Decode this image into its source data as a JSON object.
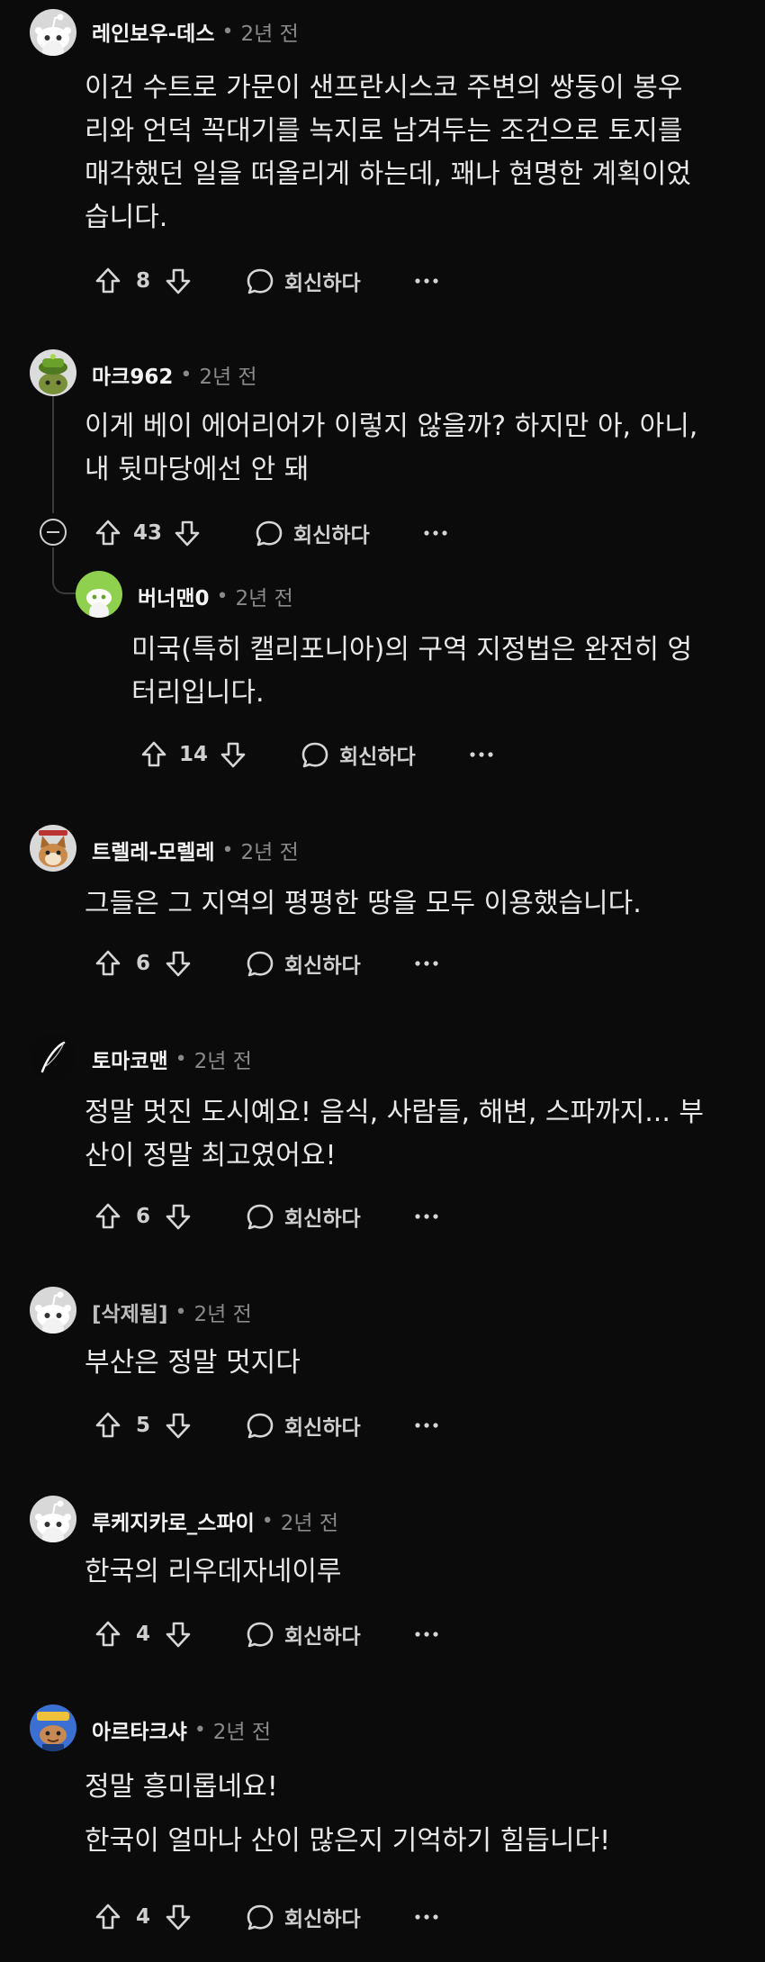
{
  "comments": [
    {
      "author": "레인보우-데스",
      "time": "2년 전",
      "lines": [
        "이건 수트로 가문이 샌프란시스코 주변의 쌍둥이 봉우",
        "리와 언덕 꼭대기를 녹지로 남겨두는 조건으로 토지를",
        "매각했던 일을 떠올리게 하는데, 꽤나 현명한 계획이었",
        "습니다."
      ],
      "score": "8",
      "reply_label": "회신하다",
      "avatar": "snoo-white-icon"
    },
    {
      "author": "마크962",
      "time": "2년 전",
      "lines": [
        "이게 베이 에어리어가 이렇지 않을까? 하지만 아, 아니,",
        "내 뒷마당에선 안 돼"
      ],
      "score": "43",
      "reply_label": "회신하다",
      "avatar": "snoo-green-hat-icon"
    },
    {
      "author": "버너맨0",
      "time": "2년 전",
      "lines": [
        "미국(특히 캘리포니아)의 구역 지정법은 완전히 엉",
        "터리입니다."
      ],
      "score": "14",
      "reply_label": "회신하다",
      "avatar": "snoo-lime-icon"
    },
    {
      "author": "트렐레-모렐레",
      "time": "2년 전",
      "lines": [
        "그들은 그 지역의 평평한 땅을 모두 이용했습니다."
      ],
      "score": "6",
      "reply_label": "회신하다",
      "avatar": "snoo-cat-icon"
    },
    {
      "author": "토마코맨",
      "time": "2년 전",
      "lines": [
        "정말 멋진 도시예요! 음식, 사람들, 해변, 스파까지... 부",
        "산이 정말 최고였어요!"
      ],
      "score": "6",
      "reply_label": "회신하다",
      "avatar": "feather-icon"
    },
    {
      "author": "[삭제됨]",
      "time": "2년 전",
      "lines": [
        "부산은 정말 멋지다"
      ],
      "score": "5",
      "reply_label": "회신하다",
      "avatar": "snoo-white-icon"
    },
    {
      "author": "루케지카로_스파이",
      "time": "2년 전",
      "lines": [
        "한국의 리우데자네이루"
      ],
      "score": "4",
      "reply_label": "회신하다",
      "avatar": "snoo-white-icon"
    },
    {
      "author": "아르타크샤",
      "time": "2년 전",
      "lines": [
        "정말 흥미롭네요!",
        "",
        "한국이 얼마나 산이 많은지 기억하기 힘듭니다!"
      ],
      "score": "4",
      "reply_label": "회신하다",
      "avatar": "snoo-blue-icon"
    }
  ],
  "separator": "•",
  "colors": {
    "background": "#0b0b0c",
    "text": "#e8e8e8",
    "meta": "#8a8a8a",
    "thread_line": "#3b3b3e"
  }
}
